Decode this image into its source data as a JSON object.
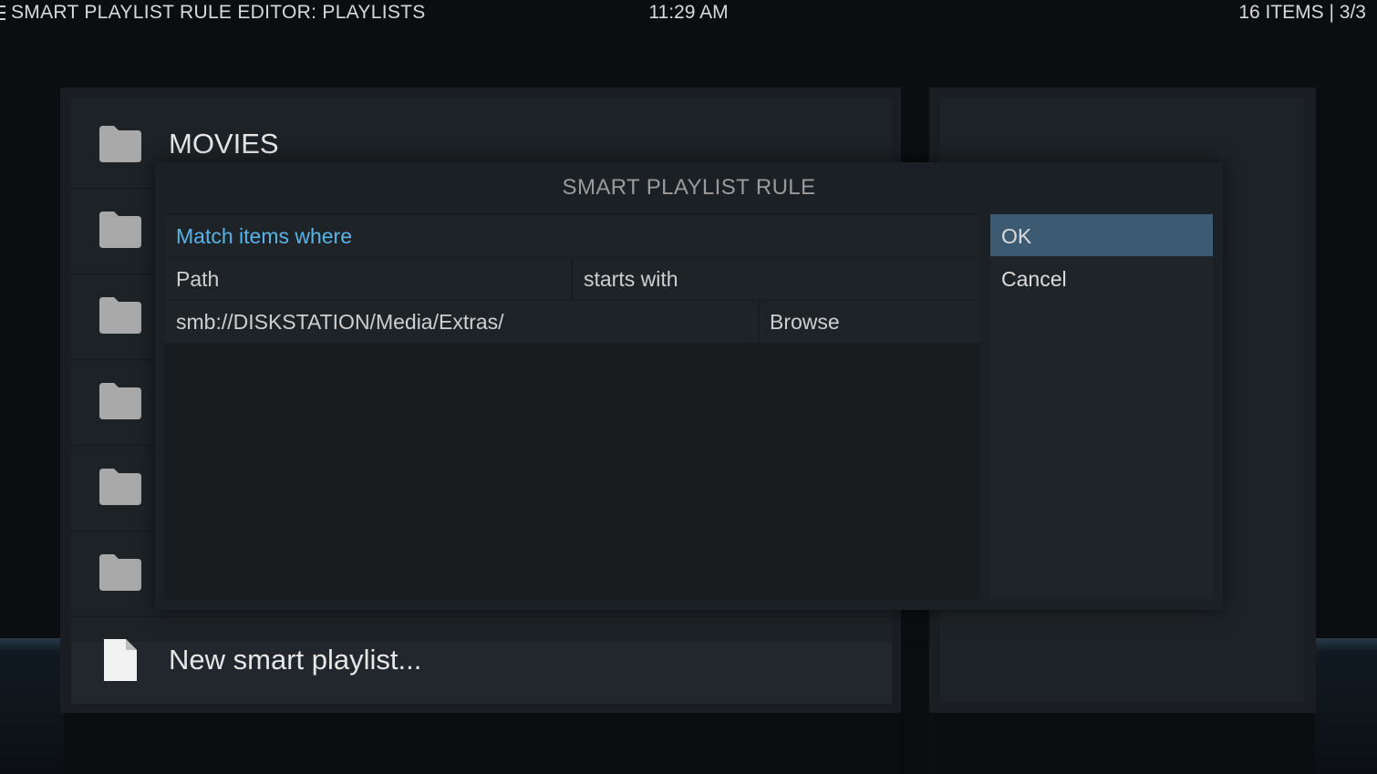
{
  "header": {
    "window_title": "SMART PLAYLIST RULE EDITOR: PLAYLISTS",
    "clock": "11:29 AM",
    "item_count": "16 ITEMS | 3/3"
  },
  "list": {
    "items": [
      {
        "label": "MOVIES",
        "icon": "folder-icon"
      },
      {
        "label": "",
        "icon": "folder-icon"
      },
      {
        "label": "",
        "icon": "folder-icon"
      },
      {
        "label": "",
        "icon": "folder-icon"
      },
      {
        "label": "",
        "icon": "folder-icon"
      },
      {
        "label": "",
        "icon": "folder-icon"
      }
    ],
    "new_item": {
      "label": "New smart playlist...",
      "icon": "file-icon"
    }
  },
  "dialog": {
    "title": "SMART PLAYLIST RULE",
    "match_label": "Match items where",
    "field": "Path",
    "operator": "starts with",
    "value": "smb://DISKSTATION/Media/Extras/",
    "browse_label": "Browse",
    "ok_label": "OK",
    "cancel_label": "Cancel"
  },
  "colors": {
    "accent": "#5ab3e6",
    "focused_button": "#3c5a72",
    "dialog_bg": "#1b2024"
  }
}
